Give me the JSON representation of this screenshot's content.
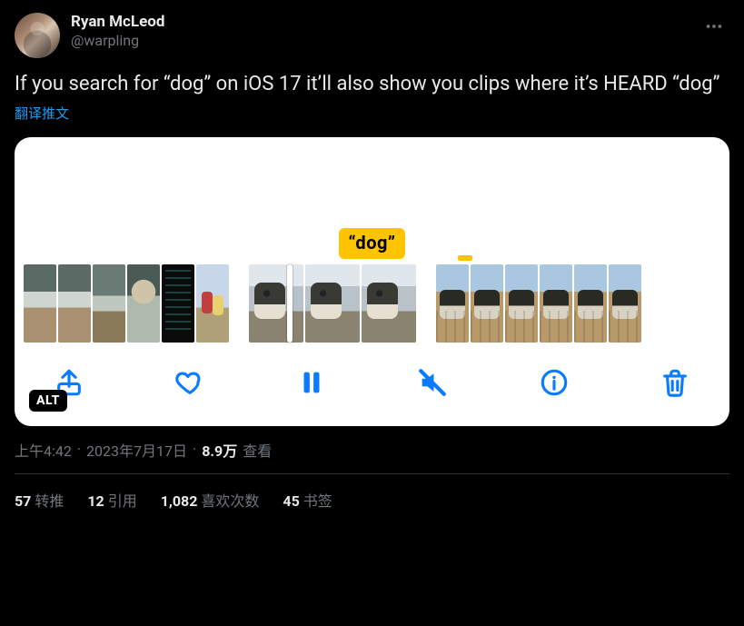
{
  "user": {
    "display_name": "Ryan McLeod",
    "handle": "@warpling"
  },
  "tweet_text": "If you search for “dog” on iOS 17 it’ll also show you clips where it’s HEARD “dog”",
  "translate_label": "翻译推文",
  "caption_text": "“dog”",
  "alt_badge": "ALT",
  "meta": {
    "time": "上午4:42",
    "date": "2023年7月17日",
    "sep": "·",
    "views_number": "8.9万",
    "views_label": "查看"
  },
  "stats": {
    "retweets_n": "57",
    "retweets_label": "转推",
    "quotes_n": "12",
    "quotes_label": "引用",
    "likes_n": "1,082",
    "likes_label": "喜欢次数",
    "bookmarks_n": "45",
    "bookmarks_label": "书签"
  },
  "icons": {
    "more": "more-icon",
    "share": "share-icon",
    "heart": "heart-icon",
    "pause": "pause-icon",
    "mute": "mute-icon",
    "info": "info-icon",
    "trash": "trash-icon"
  }
}
